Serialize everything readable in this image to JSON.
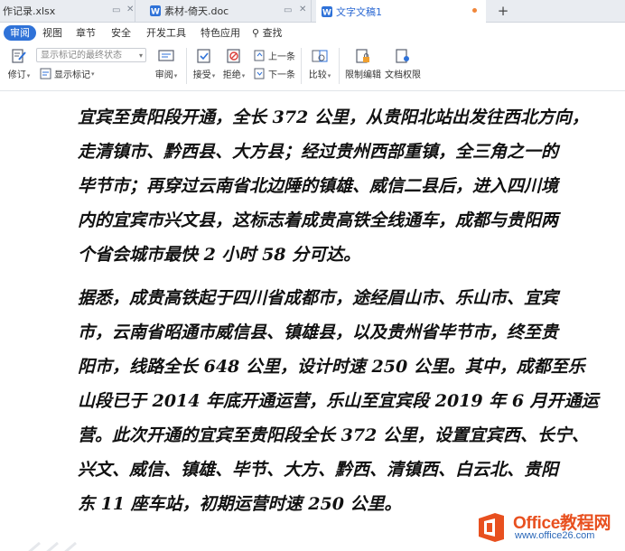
{
  "tabs": [
    {
      "label": "作记录.xlsx",
      "color": "#1f9d55"
    },
    {
      "label": "素材-倚天.doc",
      "color": "#2f72d8"
    },
    {
      "label": "文字文稿1",
      "color": "#2f72d8",
      "active": true
    }
  ],
  "new_tab": "+",
  "menu": {
    "items": [
      "审阅",
      "视图",
      "章节",
      "安全",
      "开发工具",
      "特色应用"
    ],
    "search": "查找"
  },
  "toolbar": {
    "track_changes": "修订",
    "display_status": "显示标记的最终状态",
    "show_markup": "显示标记",
    "review": "审阅",
    "accept": "接受",
    "reject": "拒绝",
    "previous": "上一条",
    "next": "下一条",
    "compare": "比较",
    "restrict_editing": "限制编辑",
    "doc_permissions": "文档权限"
  },
  "document": {
    "paragraph1": [
      "宜宾至贵阳段开通，全长 372 公里，从贵阳北站出发往西北方向，",
      "走清镇市、黔西县、大方县；经过贵州西部重镇，全三角之一的",
      "毕节市；再穿过云南省北边陲的镇雄、威信二县后，进入四川境",
      "内的宜宾市兴文县，这标志着成贵高铁全线通车，成都与贵阳两",
      "个省会城市最快 2 小时 58 分可达。"
    ],
    "paragraph2": [
      "据悉，成贵高铁起于四川省成都市，途经眉山市、乐山市、宜宾",
      "市，云南省昭通市威信县、镇雄县，以及贵州省毕节市，终至贵",
      "阳市，线路全长 648 公里，设计时速 250 公里。其中，成都至乐",
      "山段已于 2014 年底开通运营，乐山至宜宾段 2019 年 6 月开通运",
      "营。此次开通的宜宾至贵阳段全长 372 公里，设置宜宾西、长宁、",
      "兴文、威信、镇雄、毕节、大方、黔西、清镇西、白云北、贵阳",
      "东 11 座车站，初期运营时速 250 公里。"
    ]
  },
  "watermark": {
    "name": "Office教程网",
    "url": "www.office26.com"
  },
  "colors": {
    "accent": "#2f72d8",
    "watermark_orange": "#e8501f",
    "watermark_blue": "#2a67b8"
  }
}
